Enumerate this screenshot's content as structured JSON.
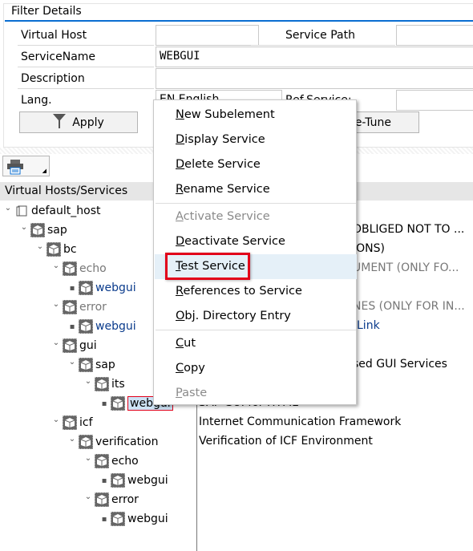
{
  "filter": {
    "title": "Filter Details",
    "virtual_host_label": "Virtual Host",
    "virtual_host_value": "",
    "service_path_label": "Service Path",
    "service_path_value": "",
    "service_name_label": "ServiceName",
    "service_name_value": "WEBGUI",
    "description_label": "Description",
    "description_value": "",
    "lang_label": "Lang.",
    "lang_value": "EN English",
    "ref_service_label": "Ref.Service:",
    "apply_label": "Apply",
    "fine_tune_label": "Fine-Tune"
  },
  "toolbar": {
    "print_icon": "printer-icon"
  },
  "tree": {
    "header": "Virtual Hosts/Services",
    "rows": [
      {
        "label": "default_host",
        "level": 0,
        "expand": true,
        "icon": "host-icon",
        "style": ""
      },
      {
        "label": "sap",
        "level": 1,
        "expand": true,
        "icon": "package-icon",
        "style": ""
      },
      {
        "label": "bc",
        "level": 2,
        "expand": true,
        "icon": "package-icon",
        "style": ""
      },
      {
        "label": "echo",
        "level": 3,
        "expand": true,
        "icon": "package-icon",
        "style": "gray"
      },
      {
        "label": "webgui",
        "level": 4,
        "expand": false,
        "icon": "package-icon",
        "style": "blue"
      },
      {
        "label": "error",
        "level": 3,
        "expand": true,
        "icon": "package-icon",
        "style": "gray"
      },
      {
        "label": "webgui",
        "level": 4,
        "expand": false,
        "icon": "package-icon",
        "style": "blue"
      },
      {
        "label": "gui",
        "level": 3,
        "expand": true,
        "icon": "package-icon",
        "style": ""
      },
      {
        "label": "sap",
        "level": 4,
        "expand": true,
        "icon": "package-icon",
        "style": ""
      },
      {
        "label": "its",
        "level": 5,
        "expand": true,
        "icon": "package-icon",
        "style": ""
      },
      {
        "label": "webgui",
        "level": 6,
        "expand": false,
        "icon": "package-icon",
        "style": "",
        "selected": true
      },
      {
        "label": "icf",
        "level": 3,
        "expand": true,
        "icon": "package-icon",
        "style": ""
      },
      {
        "label": "verification",
        "level": 4,
        "expand": true,
        "icon": "package-icon",
        "style": ""
      },
      {
        "label": "echo",
        "level": 5,
        "expand": true,
        "icon": "package-icon",
        "style": ""
      },
      {
        "label": "webgui",
        "level": 6,
        "expand": false,
        "icon": "package-icon",
        "style": ""
      },
      {
        "label": "error",
        "level": 5,
        "expand": true,
        "icon": "package-icon",
        "style": ""
      },
      {
        "label": "webgui",
        "level": 6,
        "expand": false,
        "icon": "package-icon",
        "style": ""
      }
    ]
  },
  "descriptions": [
    {
      "row": 1,
      "text": "OBLIGED NOT TO ...",
      "style": "",
      "partial": true
    },
    {
      "row": 2,
      "text": "IONS)",
      "style": "",
      "partial": true
    },
    {
      "row": 3,
      "text": "UMENT (ONLY FO...",
      "style": "gray",
      "partial": true
    },
    {
      "row": 5,
      "text": "NES (ONLY FOR IN...",
      "style": "gray",
      "partial": true
    },
    {
      "row": 6,
      "text": "Link",
      "style": "blue",
      "partial": true
    },
    {
      "row": 8,
      "text": "sed GUI Services",
      "style": "",
      "partial": true
    },
    {
      "row": 10,
      "text": "SAP GUI for HTML",
      "style": "",
      "partial": false
    },
    {
      "row": 11,
      "text": "Internet Communication Framework",
      "style": "",
      "partial": false
    },
    {
      "row": 12,
      "text": "Verification of ICF Environment",
      "style": "",
      "partial": false
    }
  ],
  "context_menu": {
    "items": [
      {
        "label": "New Subelement",
        "mnemonic": 0,
        "disabled": false
      },
      {
        "label": "Display Service",
        "mnemonic": 0,
        "disabled": false
      },
      {
        "label": "Delete Service",
        "mnemonic": 0,
        "disabled": false
      },
      {
        "label": "Rename Service",
        "mnemonic": 0,
        "disabled": false,
        "sep_after": true
      },
      {
        "label": "Activate Service",
        "mnemonic": 0,
        "disabled": true
      },
      {
        "label": "Deactivate Service",
        "mnemonic": 0,
        "disabled": false
      },
      {
        "label": "Test Service",
        "mnemonic": 0,
        "disabled": false,
        "highlighted": true
      },
      {
        "label": "References to Service",
        "mnemonic": 0,
        "disabled": false
      },
      {
        "label": "Obj. Directory Entry",
        "mnemonic": 0,
        "disabled": false,
        "sep_after": true
      },
      {
        "label": "Cut",
        "mnemonic": 0,
        "disabled": false
      },
      {
        "label": "Copy",
        "mnemonic": 0,
        "disabled": false
      },
      {
        "label": "Paste",
        "mnemonic": 0,
        "disabled": true
      }
    ]
  },
  "colors": {
    "accent": "#0a6ed1",
    "highlight_box": "#e2001a",
    "menu_hover": "#e5f0f8",
    "link": "#0a3b8c"
  }
}
